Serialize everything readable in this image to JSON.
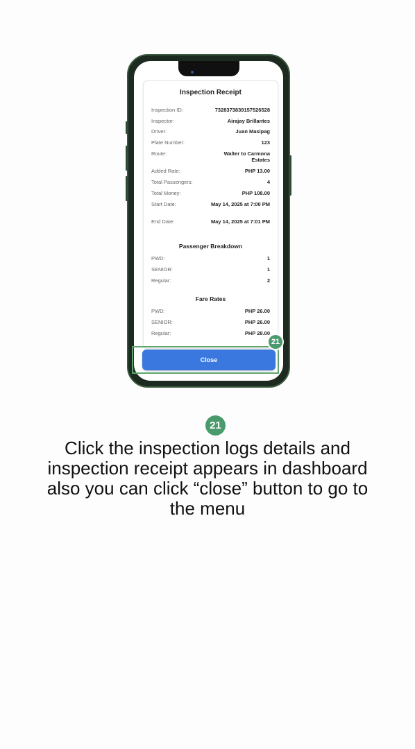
{
  "receipt": {
    "title": "Inspection Receipt",
    "fields": [
      {
        "label": "Inspection ID:",
        "value": "7328373839157526528"
      },
      {
        "label": "Inspector:",
        "value": "Airajay Brillantes"
      },
      {
        "label": "Driver:",
        "value": "Juan Masipag"
      },
      {
        "label": "Plate Number:",
        "value": "123"
      },
      {
        "label": "Route:",
        "value": "Walter to Carmona Estates"
      },
      {
        "label": "Added Rate:",
        "value": "PHP 13.00"
      },
      {
        "label": "Total Passengers:",
        "value": "4"
      },
      {
        "label": "Total Money:",
        "value": "PHP 108.00"
      },
      {
        "label": "Start Date:",
        "value": "May 14, 2025 at 7:00 PM"
      },
      {
        "label": "End Date:",
        "value": "May 14, 2025 at 7:01 PM"
      }
    ],
    "breakdown_title": "Passenger Breakdown",
    "breakdown": [
      {
        "label": "PWD:",
        "value": "1"
      },
      {
        "label": "SENIOR:",
        "value": "1"
      },
      {
        "label": "Regular:",
        "value": "2"
      }
    ],
    "fares_title": "Fare Rates",
    "fares": [
      {
        "label": "PWD:",
        "value": "PHP 26.00"
      },
      {
        "label": "SENIOR:",
        "value": "PHP 26.00"
      },
      {
        "label": "Regular:",
        "value": "PHP 28.00"
      }
    ]
  },
  "close_label": "Close",
  "step_number": "21",
  "instruction": "Click the inspection logs details and inspection receipt appears in dashboard also you can click “close” button to go to the menu",
  "colors": {
    "accent": "#3a78e0",
    "step_badge": "#4a9a6c",
    "highlight": "#5fa56d"
  }
}
